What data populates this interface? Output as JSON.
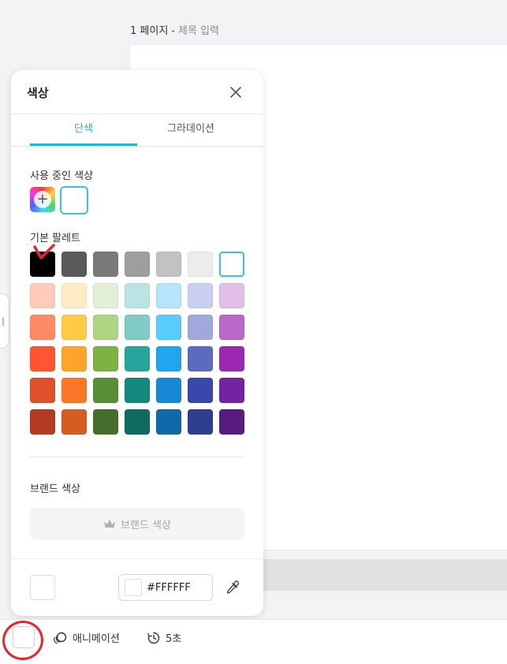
{
  "header": {
    "page_label": "1 페이지",
    "separator": "-",
    "title_placeholder": "제목 입력"
  },
  "panel": {
    "title": "색상",
    "tabs": [
      {
        "label": "단색",
        "active": true
      },
      {
        "label": "그라데이션",
        "active": false
      }
    ],
    "used_colors_label": "사용 중인 색상",
    "used_colors": [
      "#FFFFFF"
    ],
    "basic_palette_label": "기본 팔레트",
    "palette_rows": [
      [
        "#000000",
        "#5a5a5a",
        "#7a7a7a",
        "#9e9e9e",
        "#c2c2c2",
        "#ececec",
        "#ffffff"
      ],
      [
        "#ffccbc",
        "#ffecc4",
        "#e0efd6",
        "#b9e4e1",
        "#b6e5fb",
        "#c9cff0",
        "#e2bfe6"
      ],
      [
        "#ff8a65",
        "#ffcb45",
        "#aed581",
        "#80cbc4",
        "#58ccfb",
        "#9faadb",
        "#ba68c8"
      ],
      [
        "#ff5532",
        "#ffa32a",
        "#7cb342",
        "#26a69a",
        "#1ea7ec",
        "#5c6bc0",
        "#9c27b0"
      ],
      [
        "#e0502b",
        "#ff7626",
        "#568f35",
        "#12897c",
        "#1688d4",
        "#3949ab",
        "#7424a0"
      ],
      [
        "#b23b20",
        "#d45d1f",
        "#446e2a",
        "#0d6b60",
        "#0f6aa8",
        "#2f3d8f",
        "#561c80"
      ]
    ],
    "selected_palette_color": "#ffffff",
    "brand_colors_label": "브랜드 색상",
    "brand_button_label": "브랜드 색상",
    "current_color": "#FFFFFF",
    "hex_value": "#FFFFFF"
  },
  "bottom_bar": {
    "animation_label": "애니메이션",
    "duration_label": "5초"
  },
  "icons": [
    "close-icon",
    "plus-icon",
    "crown-icon",
    "eyedropper-icon",
    "animation-icon",
    "timer-icon"
  ],
  "colors": {
    "accent": "#22b8cf",
    "annotation_red": "#e8232a"
  }
}
